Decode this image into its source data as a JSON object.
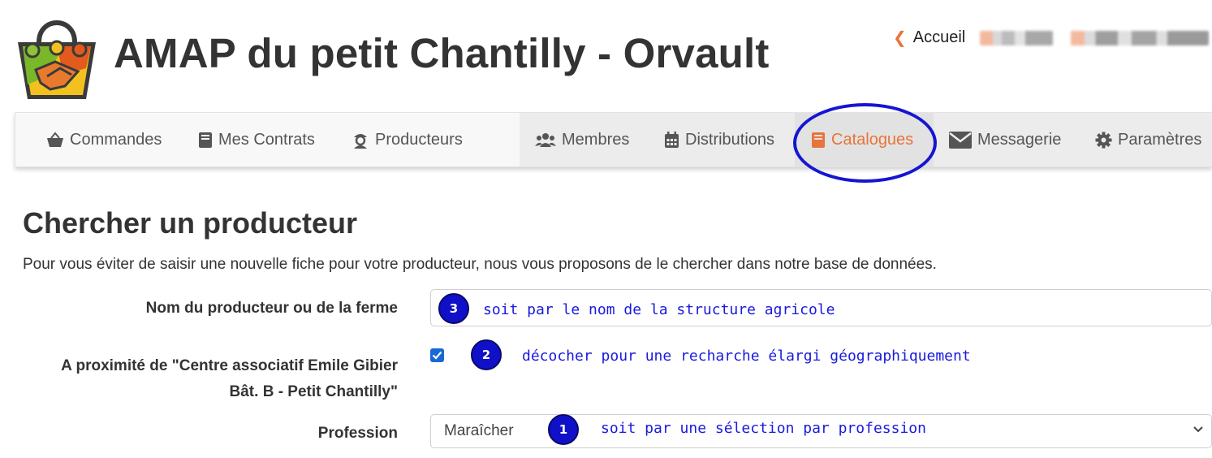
{
  "header": {
    "site_title": "AMAP du petit Chantilly - Orvault",
    "home_link": "Accueil"
  },
  "nav": {
    "items": [
      {
        "label": "Commandes",
        "icon": "basket-icon"
      },
      {
        "label": "Mes Contrats",
        "icon": "book-icon"
      },
      {
        "label": "Producteurs",
        "icon": "farmer-icon"
      },
      {
        "label": "Membres",
        "icon": "users-icon"
      },
      {
        "label": "Distributions",
        "icon": "calendar-icon"
      },
      {
        "label": "Catalogues",
        "icon": "book-icon",
        "active": true
      },
      {
        "label": "Messagerie",
        "icon": "envelope-icon"
      },
      {
        "label": "Paramètres",
        "icon": "gear-icon"
      }
    ]
  },
  "main": {
    "heading": "Chercher un producteur",
    "intro": "Pour vous éviter de saisir une nouvelle fiche pour votre producteur, nous vous proposons de le chercher dans notre base de données.",
    "fields": {
      "name_label": "Nom du producteur ou de la ferme",
      "proximity_label_line1": "A proximité de \"Centre associatif Emile Gibier",
      "proximity_label_line2": "Bât. B - Petit Chantilly\"",
      "proximity_checked": true,
      "profession_label": "Profession",
      "profession_value": "Maraîcher"
    }
  },
  "annotations": [
    {
      "number": "3",
      "text": "soit par le nom de la structure agricole"
    },
    {
      "number": "2",
      "text": "décocher pour une recharche élargi géographiquement"
    },
    {
      "number": "1",
      "text": "soit par une sélection par profession"
    }
  ],
  "colors": {
    "accent": "#e8743b",
    "annotation": "#1515d2",
    "checkbox": "#1769d4"
  }
}
